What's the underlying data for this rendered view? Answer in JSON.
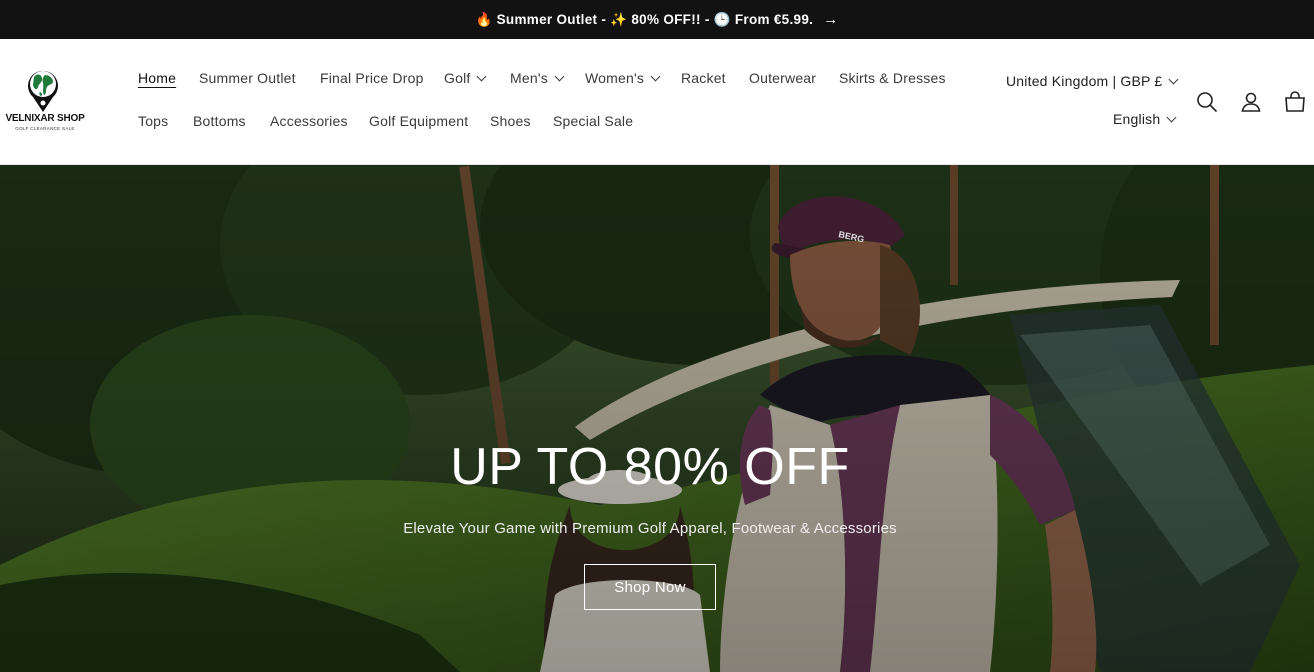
{
  "announcement": {
    "text": "🔥 Summer Outlet - ✨ 80% OFF!! - 🕒 From €5.99.",
    "arrow": "→"
  },
  "logo": {
    "brand": "VELNIXAR SHOP",
    "tagline": "GOLF CLEARANCE SALE"
  },
  "nav": {
    "row1": [
      {
        "label": "Home",
        "active": true,
        "dropdown": false
      },
      {
        "label": "Summer Outlet",
        "dropdown": false
      },
      {
        "label": "Final Price Drop",
        "dropdown": false
      },
      {
        "label": "Golf",
        "dropdown": true
      },
      {
        "label": "Men's",
        "dropdown": true
      },
      {
        "label": "Women's",
        "dropdown": true
      },
      {
        "label": "Racket",
        "dropdown": false
      },
      {
        "label": "Outerwear",
        "dropdown": false
      },
      {
        "label": "Skirts & Dresses",
        "dropdown": false
      }
    ],
    "row2": [
      {
        "label": "Tops"
      },
      {
        "label": "Bottoms"
      },
      {
        "label": "Accessories"
      },
      {
        "label": "Golf Equipment"
      },
      {
        "label": "Shoes"
      },
      {
        "label": "Special Sale"
      }
    ]
  },
  "localization": {
    "country": "United Kingdom | GBP £",
    "language": "English"
  },
  "header_icons": [
    "search-icon",
    "account-icon",
    "cart-icon"
  ],
  "hero": {
    "title": "UP TO 80% OFF",
    "subtitle": "Elevate Your Game with Premium Golf Apparel, Footwear & Accessories",
    "button": "Shop Now",
    "cap_text": "BERG"
  },
  "colors": {
    "announcement_bg": "#121212",
    "text": "#222222",
    "hero_text": "#ffffff"
  }
}
